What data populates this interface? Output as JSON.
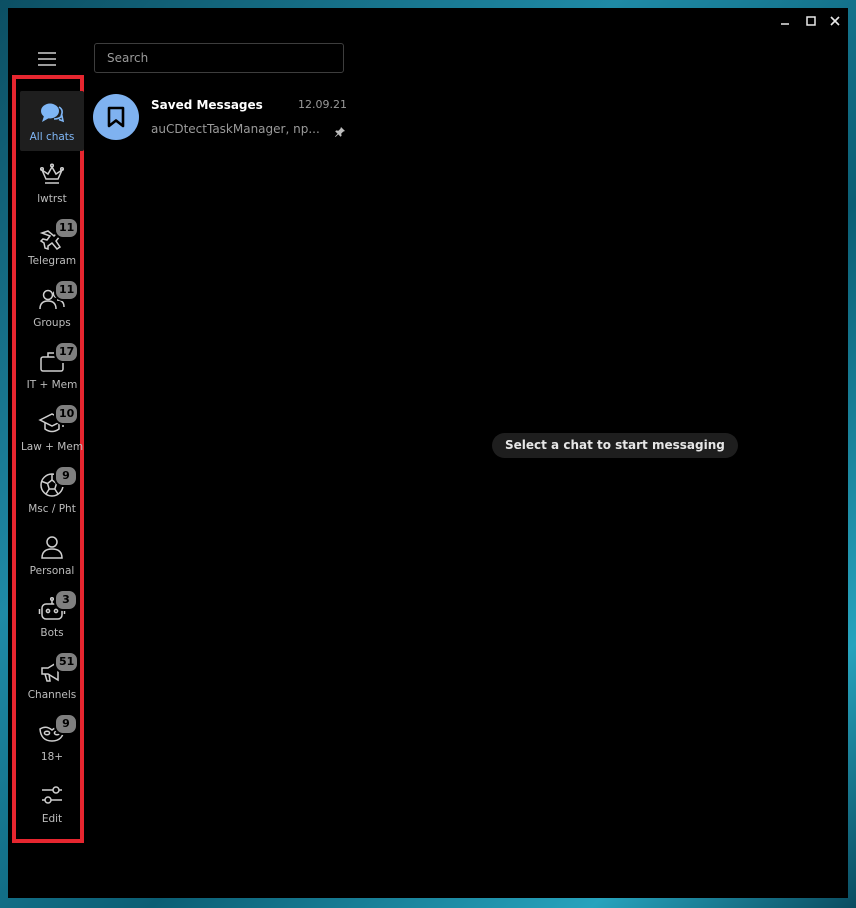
{
  "window": {
    "controls": [
      "minimize-icon",
      "maximize-icon",
      "close-icon"
    ]
  },
  "menu": {
    "icon": "hamburger-icon"
  },
  "search": {
    "placeholder": "Search"
  },
  "folders": [
    {
      "label": "All chats",
      "icon": "chats-icon",
      "badge": "",
      "active": true
    },
    {
      "label": "lwtrst",
      "icon": "crown-icon",
      "badge": ""
    },
    {
      "label": "Telegram",
      "icon": "airplane-icon",
      "badge": "11"
    },
    {
      "label": "Groups",
      "icon": "group-icon",
      "badge": "11"
    },
    {
      "label": "IT + Mem",
      "icon": "briefcase-icon",
      "badge": "17"
    },
    {
      "label": "Law + Mem",
      "icon": "graduation-cap-icon",
      "badge": "10"
    },
    {
      "label": "Msc / Pht",
      "icon": "soccer-ball-icon",
      "badge": "9"
    },
    {
      "label": "Personal",
      "icon": "person-icon",
      "badge": ""
    },
    {
      "label": "Bots",
      "icon": "bot-icon",
      "badge": "3"
    },
    {
      "label": "Channels",
      "icon": "megaphone-icon",
      "badge": "51"
    },
    {
      "label": "18+",
      "icon": "mask-icon",
      "badge": "9"
    },
    {
      "label": "Edit",
      "icon": "sliders-icon",
      "badge": ""
    }
  ],
  "chats": [
    {
      "name": "Saved Messages",
      "date": "12.09.21",
      "preview": "auCDtectTaskManager, np...",
      "pinned": true,
      "avatar_icon": "bookmark-icon",
      "avatar_color": "#7fb2f0"
    }
  ],
  "main": {
    "empty_text": "Select a chat to start messaging"
  },
  "colors": {
    "highlight_border": "#e6262f",
    "accent": "#7fb6f5",
    "badge": "#7f7f7f",
    "background": "#000000"
  }
}
